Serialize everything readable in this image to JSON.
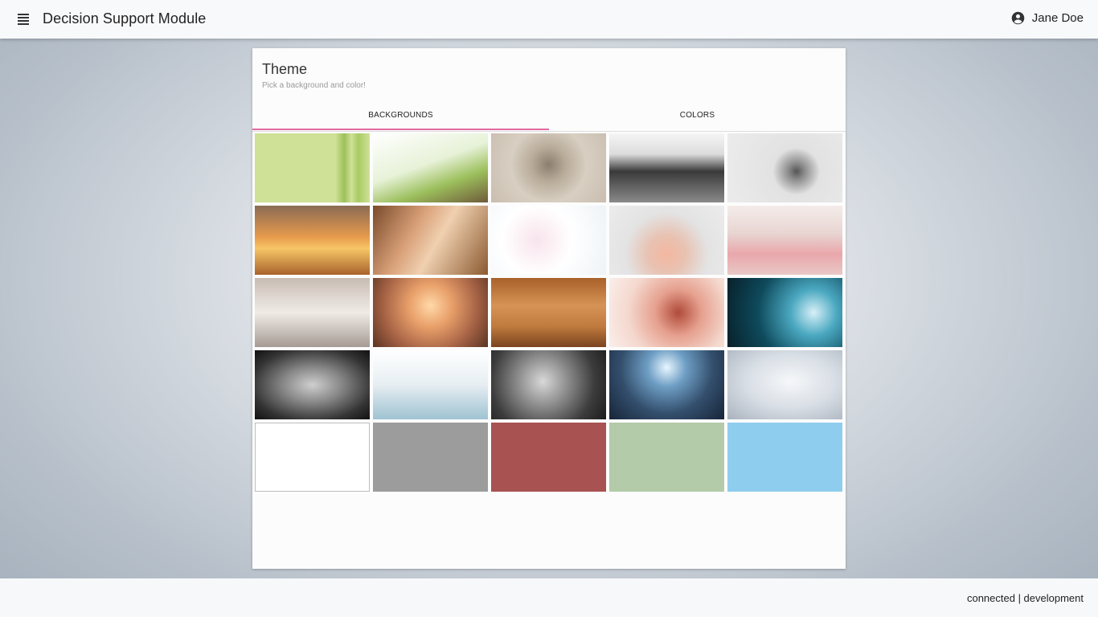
{
  "header": {
    "app_title": "Decision Support Module",
    "menu_icon": "menu-icon",
    "user_icon": "account-circle-icon",
    "user_name": "Jane Doe"
  },
  "card": {
    "title": "Theme",
    "subtitle": "Pick a background and color!",
    "tabs": [
      {
        "label": "BACKGROUNDS",
        "active": true
      },
      {
        "label": "COLORS",
        "active": false
      }
    ],
    "accent_color": "#e26a9f"
  },
  "tiles": [
    {
      "name": "bamboo",
      "fill": "linear-gradient(90deg,#cfe196 0%,#cfe196 70%,#9cc05a 78%,#cfe196 84%,#aacb65 90%,#cfe196 100%)"
    },
    {
      "name": "bamboo-leaves-spa",
      "fill": "linear-gradient(160deg,#ffffff 0%,#e7f2d8 45%,#9cbf5c 70%,#6f5a3a 100%)"
    },
    {
      "name": "zen-stones-sand",
      "fill": "radial-gradient(circle at 50% 45%,#8a7e70 0%,#b8ab99 25%,#d8cfc2 55%,#c9bdaf 100%)"
    },
    {
      "name": "black-stones-water",
      "fill": "linear-gradient(180deg,#f5f5f5 0%,#dcdcdc 30%,#3a3a3a 55%,#8a8a8a 100%)"
    },
    {
      "name": "yoga-stretch",
      "fill": "radial-gradient(circle at 60% 55%,#555 0%,#8a8a8a 10%,#e2e2e2 30%,#ececec 100%)"
    },
    {
      "name": "yoga-sunset",
      "fill": "linear-gradient(180deg,#8b6b55 0%,#e69a4c 45%,#f7c667 62%,#a8622c 100%)"
    },
    {
      "name": "massage",
      "fill": "linear-gradient(120deg,#7a4a2a 0%,#d8a078 35%,#f0d0b0 55%,#8a5a30 100%)"
    },
    {
      "name": "flower-petals-bath",
      "fill": "radial-gradient(circle at 40% 50%,#f8e4ec 0%,#ffffff 45%,#eef3f7 100%)"
    },
    {
      "name": "cream-jar",
      "fill": "radial-gradient(circle at 50% 70%,#f4b7a0 0%,#e8c2b2 25%,#e3e3e3 55%,#ececec 100%)"
    },
    {
      "name": "pink-jars",
      "fill": "linear-gradient(180deg,#f4ecea 0%,#e8d5d2 40%,#e9a7ab 70%,#e9c8c6 100%)"
    },
    {
      "name": "spa-loungers",
      "fill": "linear-gradient(180deg,#c8bcb4 0%,#f0ebe6 50%,#a69b94 100%)"
    },
    {
      "name": "candles",
      "fill": "radial-gradient(circle at 50% 40%,#ffd9a8 0%,#e9a06a 30%,#a86446 65%,#5a3322 100%)"
    },
    {
      "name": "sauna",
      "fill": "linear-gradient(180deg,#a8612a 0%,#d79355 40%,#c07a3e 70%,#7a4420 100%)"
    },
    {
      "name": "dna-pink",
      "fill": "radial-gradient(circle at 60% 50%,#b04a3a 0%,#e6a08e 30%,#f4d8ce 65%,#fbeeea 100%)"
    },
    {
      "name": "dna-blue",
      "fill": "radial-gradient(circle at 75% 50%,#d8f0f8 0%,#4aa8c0 25%,#0e4a5c 60%,#08202a 100%)"
    },
    {
      "name": "chest-xray",
      "fill": "radial-gradient(ellipse at 50% 50%,#cfcfcf 0%,#8a8a8a 35%,#333 75%,#111 100%)"
    },
    {
      "name": "clinic-ward",
      "fill": "linear-gradient(180deg,#ffffff 0%,#e6eef2 50%,#9fc3d2 100%)"
    },
    {
      "name": "mri-room",
      "fill": "radial-gradient(circle at 45% 45%,#d9d9d9 0%,#8a8a8a 35%,#3c3c3c 70%,#1c1c1c 100%)"
    },
    {
      "name": "sci-fi-hall",
      "fill": "radial-gradient(circle at 50% 25%,#e8f6ff 0%,#6e9ec4 25%,#334e6c 60%,#172538 100%)"
    },
    {
      "name": "grey-vignette",
      "fill": "radial-gradient(ellipse at 55% 45%,#f6f7f9 0%,#d8dee5 50%,#a9b3be 100%)"
    },
    {
      "name": "white",
      "fill": "#ffffff",
      "bordered": true
    },
    {
      "name": "grey",
      "fill": "#9c9c9c"
    },
    {
      "name": "red",
      "fill": "#a85252"
    },
    {
      "name": "green",
      "fill": "#b3cba8"
    },
    {
      "name": "blue",
      "fill": "#8fcdee"
    }
  ],
  "footer": {
    "status": "connected | development"
  }
}
